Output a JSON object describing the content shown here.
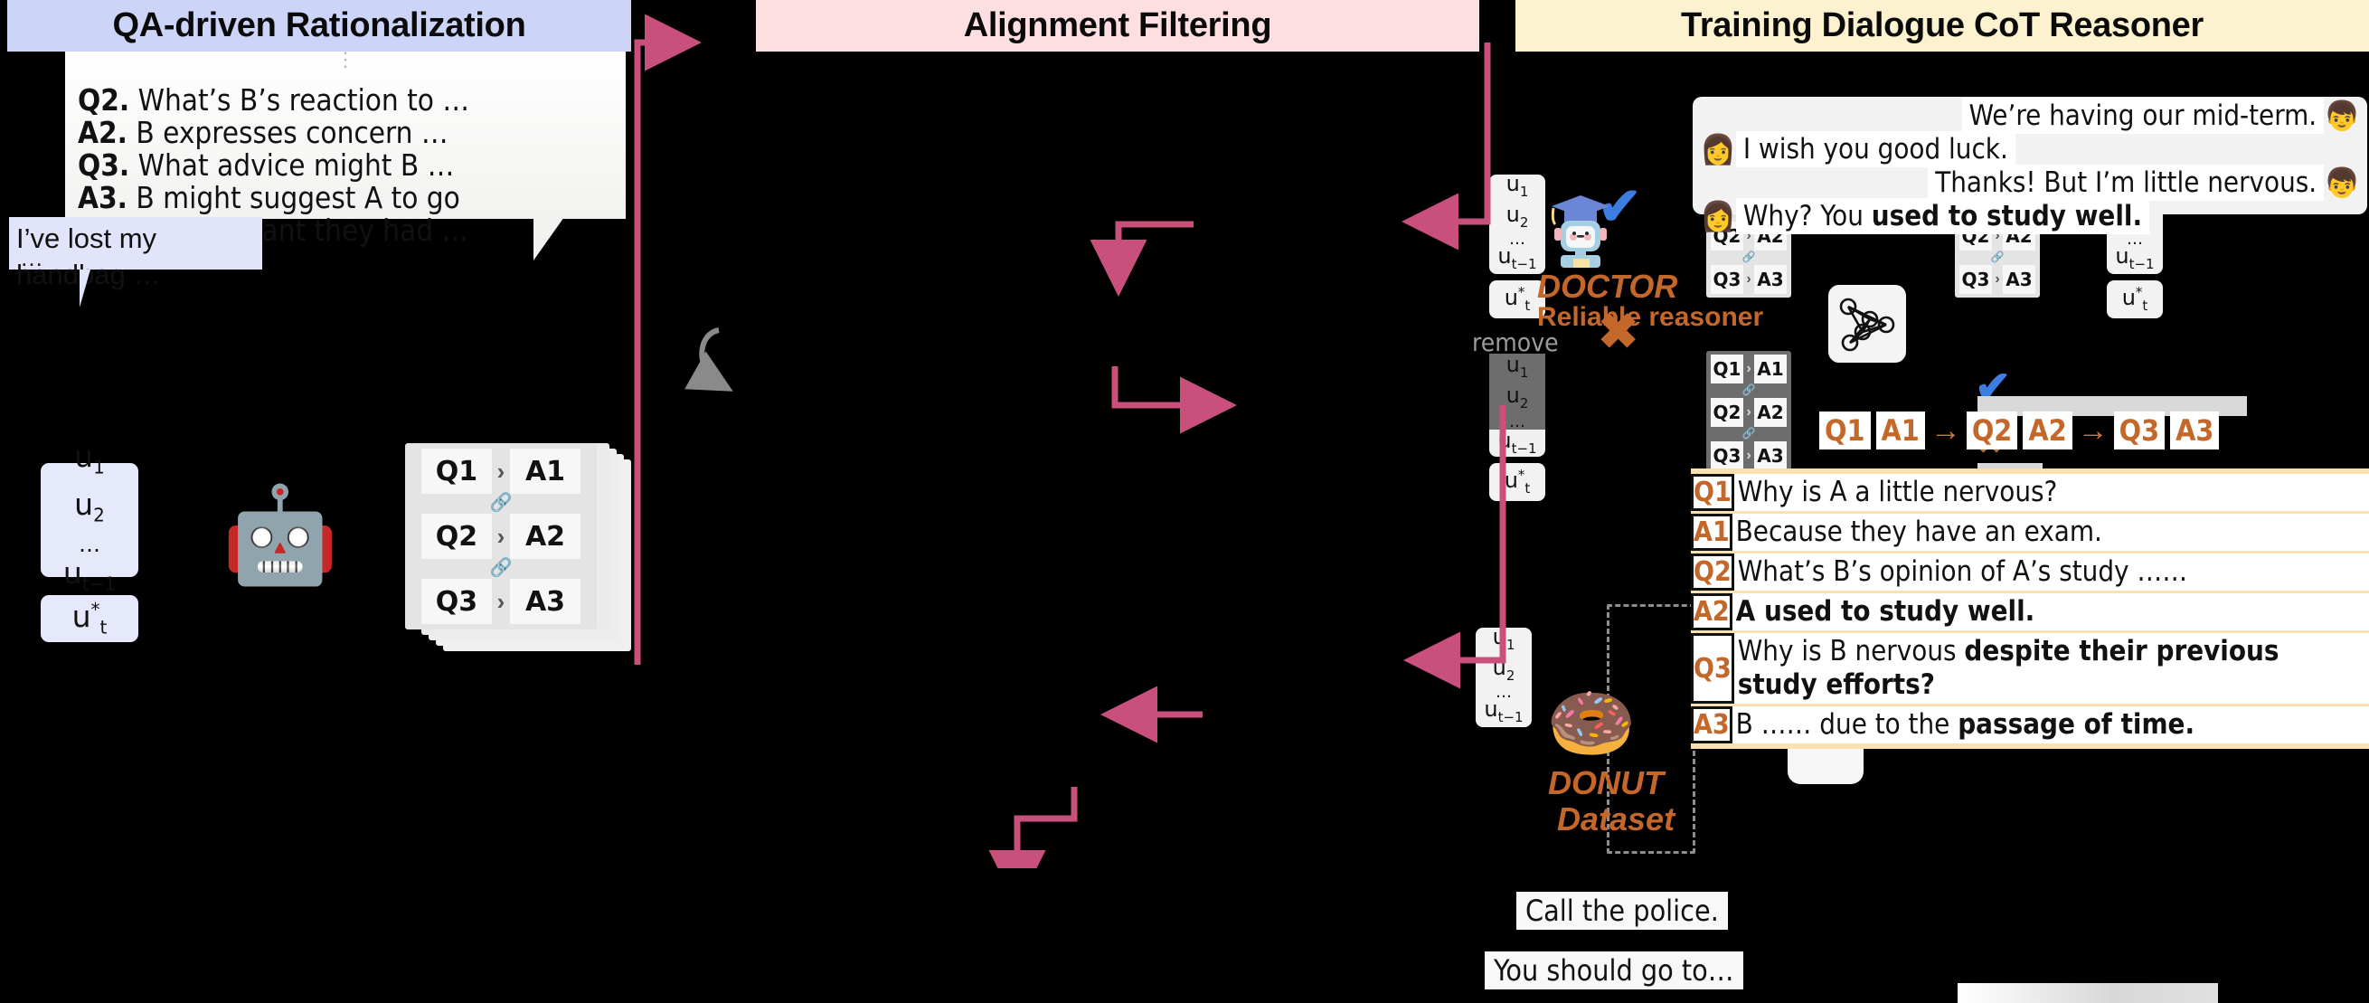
{
  "headers": {
    "left": "QA-driven Rationalization",
    "mid": "Alignment Filtering",
    "right": "Training Dialogue CoT Reasoner"
  },
  "colors": {
    "header_left_bg": "#ccd4f7",
    "header_mid_bg": "#fddfe2",
    "header_right_bg": "#fcf2d0",
    "arrow_pink": "#c94f7c",
    "accent_orange": "#c4672a",
    "tick_blue": "#3b7de0",
    "cross_orange": "#c4672a",
    "table_band": "#fbe0b0"
  },
  "left_panel": {
    "vdots": "⋮",
    "qa_lines": [
      {
        "tag": "Q2.",
        "text": "What’s B’s reaction to …"
      },
      {
        "tag": "A2.",
        "text": "B expresses concern …"
      },
      {
        "tag": "Q3.",
        "text": "What advice might B …"
      },
      {
        "tag": "A3.",
        "text": "B might suggest A to go"
      },
      {
        "tag": "",
        "text": "to the restaurant they had …"
      }
    ],
    "lost_bubble": "I’ve lost my handbag …",
    "lost_bubble_dots": "…",
    "u_context": [
      "u₁",
      "u₂",
      "…",
      "uₜ₋₁"
    ],
    "u_target": "u*ₜ",
    "robot_icon": "robot-icon",
    "qa_chain": [
      {
        "q": "Q1",
        "a": "A1"
      },
      {
        "q": "Q2",
        "a": "A2"
      },
      {
        "q": "Q3",
        "a": "A3"
      }
    ],
    "chain_arrow": "›",
    "link_icon": "link-icon"
  },
  "mid_panel": {
    "remove_label": "remove",
    "tick_glyph": "✔",
    "cross_glyph": "✖",
    "nn_icon": "neural-network-icon",
    "speech_icon": "speech-bubble-icon",
    "u_context": [
      "u₁",
      "u₂",
      "…",
      "uₜ₋₁"
    ],
    "u_target": "u*ₜ",
    "qa_chain": [
      {
        "q": "Q1",
        "a": "A1"
      },
      {
        "q": "Q2",
        "a": "A2"
      },
      {
        "q": "Q3",
        "a": "A3"
      }
    ],
    "response_kept": "Call the police.",
    "response_rejected": "You should go to…"
  },
  "right_panel": {
    "chat": [
      {
        "speaker": "B",
        "side": "right",
        "text": "We’re having our mid-term.",
        "bold": "",
        "face": "👦"
      },
      {
        "speaker": "A",
        "side": "left",
        "text": "I wish you good luck.",
        "bold": "",
        "face": "👩"
      },
      {
        "speaker": "B",
        "side": "right",
        "text": "Thanks! But I’m little nervous.",
        "bold": "",
        "face": "👦"
      },
      {
        "speaker": "A",
        "side": "left",
        "text": "Why? You ",
        "bold": "used to study well.",
        "face": "👩"
      }
    ],
    "doctor": {
      "icon": "graduate-robot-icon",
      "name": "DOCTOR",
      "subtitle": "Reliable reasoner"
    },
    "donut": {
      "icon": "donut-icon",
      "name": "DONUT",
      "subtitle": "Dataset"
    },
    "qchain": [
      "Q1",
      "A1",
      "→",
      "Q2",
      "A2",
      "→",
      "Q3",
      "A3"
    ],
    "qa_table": [
      {
        "tag": "Q1",
        "text": "Why is A a little nervous?",
        "bold": ""
      },
      {
        "tag": "A1",
        "text": "Because they have an exam.",
        "bold": ""
      },
      {
        "tag": "Q2",
        "text": "What’s B’s opinion of A’s study ……",
        "bold": ""
      },
      {
        "tag": "A2",
        "text": "",
        "bold": "A used to study well."
      },
      {
        "tag": "Q3",
        "text": "Why is B nervous ",
        "bold": "despite their previous study efforts?"
      },
      {
        "tag": "A3",
        "text": "B …… due to the ",
        "bold": "passage of time."
      }
    ]
  }
}
